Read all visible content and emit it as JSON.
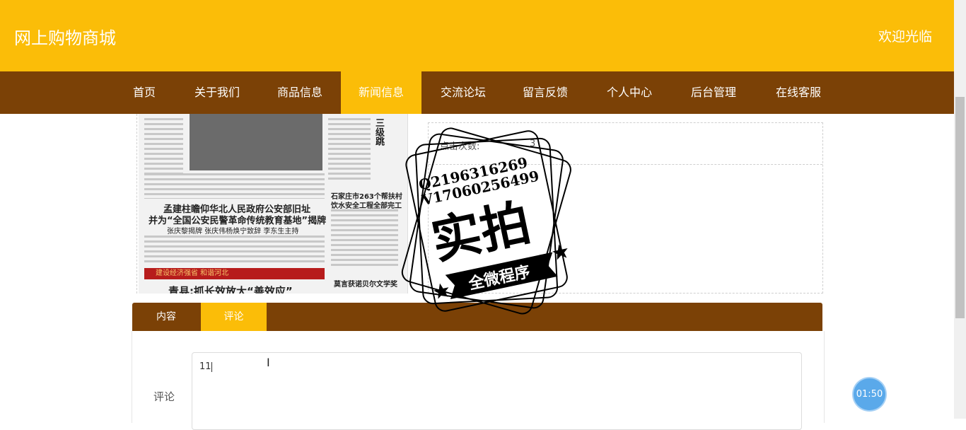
{
  "header": {
    "site_title": "网上购物商城",
    "welcome": "欢迎光临"
  },
  "nav": {
    "items": [
      {
        "label": "首页"
      },
      {
        "label": "关于我们"
      },
      {
        "label": "商品信息"
      },
      {
        "label": "新闻信息",
        "active": true
      },
      {
        "label": "交流论坛"
      },
      {
        "label": "留言反馈"
      },
      {
        "label": "个人中心"
      },
      {
        "label": "后台管理"
      },
      {
        "label": "在线客服"
      }
    ]
  },
  "news_image": {
    "heading_1": "孟建柱瞻仰华北人民政府公安部旧址",
    "heading_2": "并为“全国公安民警革命传统教育基地”揭牌",
    "heading_3": "张庆黎揭牌 张庆伟杨焕宁致辞 李东生主持",
    "side_heading_1": "石家庄市263个帮扶村",
    "side_heading_2": "饮水安全工程全部完工",
    "side_heading_3": "莫言获诺贝尔文学奖",
    "banner": "建设经济强省 和谐河北",
    "big_heading": "青县:抓长效放大“善效应”",
    "vertical_text": "三级跳"
  },
  "info": {
    "views_label": "点击次数:",
    "views_value": "3"
  },
  "watermark": {
    "line1": "Q2196316269",
    "line2": "V17060256499",
    "main": "实拍",
    "ribbon": "全微程序"
  },
  "tabs": {
    "content_label": "内容",
    "comment_label": "评论"
  },
  "comment_form": {
    "label": "评论",
    "value": "11"
  },
  "timer": {
    "text": "01:50"
  },
  "colors": {
    "primary": "#fbbd08",
    "secondary": "#7b4106"
  }
}
